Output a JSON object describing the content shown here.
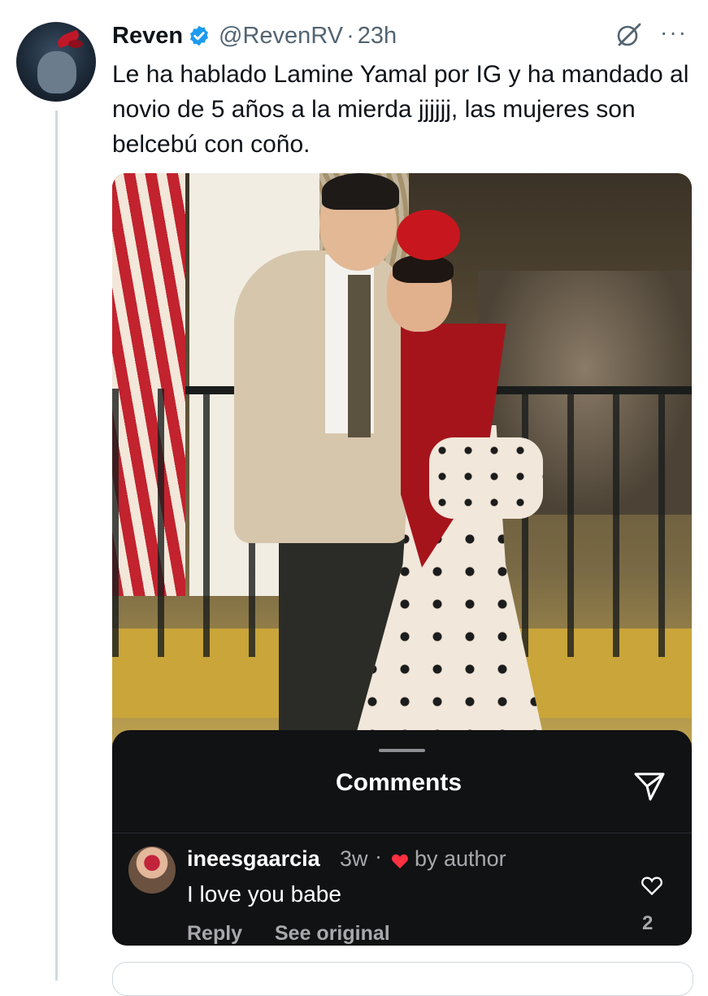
{
  "tweet": {
    "display_name": "Reven",
    "handle": "@RevenRV",
    "separator": "·",
    "time": "23h",
    "text": "Le ha hablado Lamine Yamal por IG y ha mandado al novio de 5 años a la mierda jjjjjj, las mujeres son belcebú con coño.",
    "more": "···",
    "verified_color": "#1d9bf0"
  },
  "embedded": {
    "sheet_title": "Comments",
    "comment": {
      "username": "ineesgaarcia",
      "time": "3w",
      "separator": "·",
      "badge": "by author",
      "text": "I love you babe",
      "reply_label": "Reply",
      "see_original_label": "See original",
      "like_count": "2"
    },
    "heart_color": "#ff3040",
    "sheet_bg": "#111214"
  },
  "icons": {
    "verified": "verified-badge-icon",
    "grok": "grok-icon",
    "more": "more-icon",
    "share": "share-icon",
    "like": "heart-outline-icon",
    "liked_by_author": "heart-filled-icon"
  }
}
